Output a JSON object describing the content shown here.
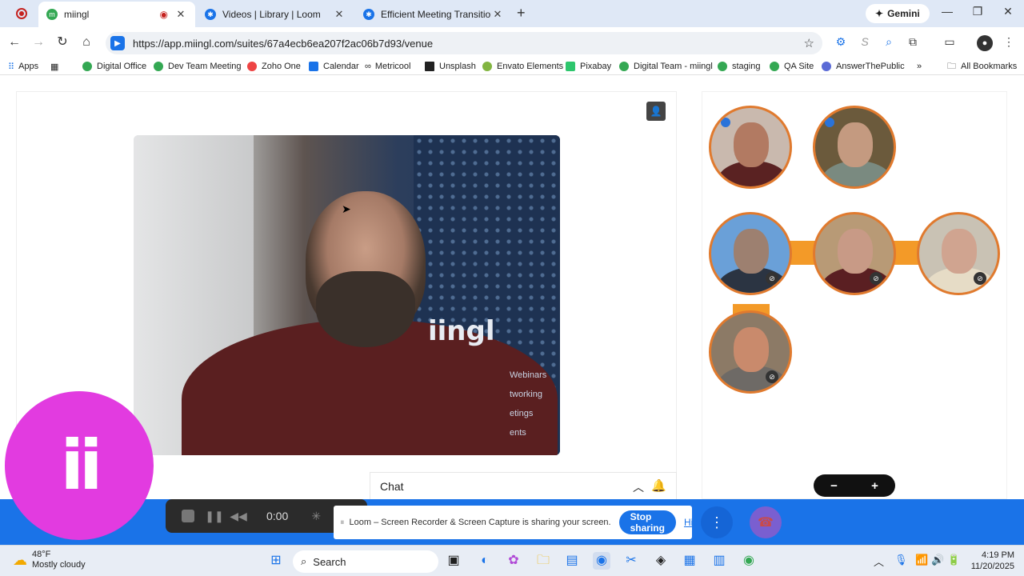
{
  "browser": {
    "tabs": [
      {
        "title": "miingl",
        "favicon_color": "#34a853"
      },
      {
        "title": "Videos | Library | Loom",
        "favicon_color": "#1a73e8"
      },
      {
        "title": "Efficient Meeting Transitions wi",
        "favicon_color": "#1a73e8"
      }
    ],
    "gemini_label": "Gemini",
    "url": "https://app.miingl.com/suites/67a4ecb6ea207f2ac06b7d93/venue"
  },
  "bookmarks": [
    {
      "label": "Apps",
      "color": "#555"
    },
    {
      "label": "Digital Office",
      "color": "#34a853"
    },
    {
      "label": "Dev Team Meeting",
      "color": "#34a853"
    },
    {
      "label": "Zoho One",
      "color": "#e44"
    },
    {
      "label": "Calendar",
      "color": "#1a73e8"
    },
    {
      "label": "Metricool",
      "color": "#222"
    },
    {
      "label": "Unsplash",
      "color": "#222"
    },
    {
      "label": "Envato Elements",
      "color": "#82b541"
    },
    {
      "label": "Pixabay",
      "color": "#2ec66d"
    },
    {
      "label": "Digital Team - miingl",
      "color": "#34a853"
    },
    {
      "label": "staging",
      "color": "#34a853"
    },
    {
      "label": "QA Site",
      "color": "#34a853"
    },
    {
      "label": "AnswerThePublic",
      "color": "#5b6bd6"
    }
  ],
  "all_bookmarks_label": "All Bookmarks",
  "video": {
    "logo_text": "iingl",
    "menu_lines": [
      "Webinars",
      "tworking",
      "etings",
      "ents"
    ]
  },
  "chat": {
    "label": "Chat"
  },
  "zoom": {
    "minus": "−",
    "plus": "+"
  },
  "brand": {
    "text": "ii",
    "color": "#e23be0"
  },
  "loom": {
    "time": "0:00",
    "message": "Loom – Screen Recorder & Screen Capture is sharing your screen.",
    "stop_label": "Stop sharing",
    "hide_label": "Hide"
  },
  "taskbar": {
    "temp": "48°F",
    "weather": "Mostly cloudy",
    "search": "Search",
    "time": "4:19 PM",
    "date": "11/20/2025"
  },
  "colors": {
    "accent": "#1a73e8",
    "ring": "#e07a2e",
    "link": "#f39a28"
  }
}
